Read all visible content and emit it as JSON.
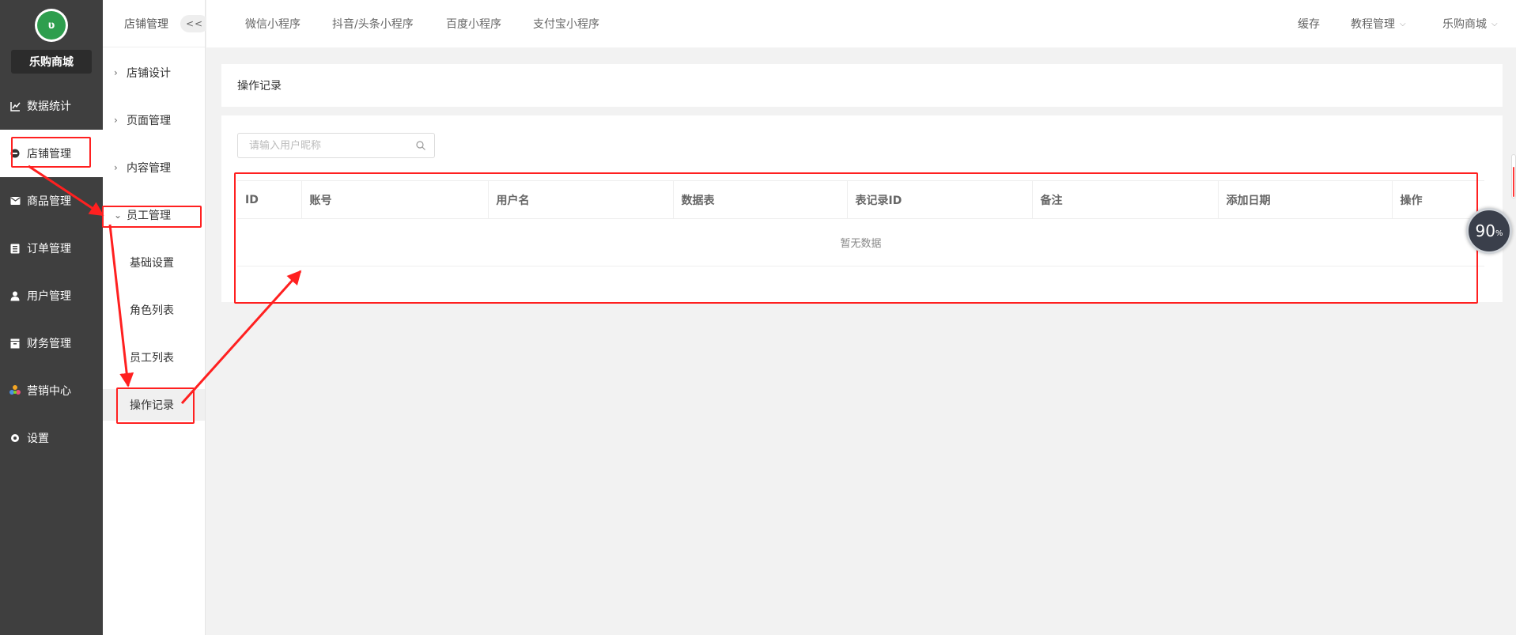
{
  "sidebar": {
    "logo_alt": "乐购商城",
    "shop_name": "乐购商城",
    "items": [
      {
        "label": "数据统计",
        "icon": "chart-icon"
      },
      {
        "label": "店铺管理",
        "icon": "store-icon"
      },
      {
        "label": "商品管理",
        "icon": "goods-icon"
      },
      {
        "label": "订单管理",
        "icon": "order-icon"
      },
      {
        "label": "用户管理",
        "icon": "user-icon"
      },
      {
        "label": "财务管理",
        "icon": "finance-icon"
      },
      {
        "label": "营销中心",
        "icon": "marketing-icon"
      },
      {
        "label": "设置",
        "icon": "settings-icon"
      }
    ]
  },
  "subbar": {
    "title": "店铺管理",
    "collapse_label": "<<",
    "groups": [
      {
        "label": "店铺设计"
      },
      {
        "label": "页面管理"
      },
      {
        "label": "内容管理"
      },
      {
        "label": "员工管理"
      }
    ],
    "children": [
      {
        "label": "基础设置"
      },
      {
        "label": "角色列表"
      },
      {
        "label": "员工列表"
      },
      {
        "label": "操作记录"
      }
    ]
  },
  "topbar": {
    "tabs": [
      "微信小程序",
      "抖音/头条小程序",
      "百度小程序",
      "支付宝小程序"
    ],
    "cache": "缓存",
    "tutorial": "教程管理",
    "store": "乐购商城"
  },
  "page": {
    "title": "操作记录",
    "search_placeholder": "请输入用户昵称",
    "columns": [
      "ID",
      "账号",
      "用户名",
      "数据表",
      "表记录ID",
      "备注",
      "添加日期",
      "操作"
    ],
    "empty_text": "暂无数据"
  },
  "widget": {
    "value": "90",
    "unit": "%"
  },
  "colors": {
    "sidebar_bg": "#3f3f3f",
    "annotation_red": "#ff2020",
    "page_bg": "#f2f2f2"
  }
}
